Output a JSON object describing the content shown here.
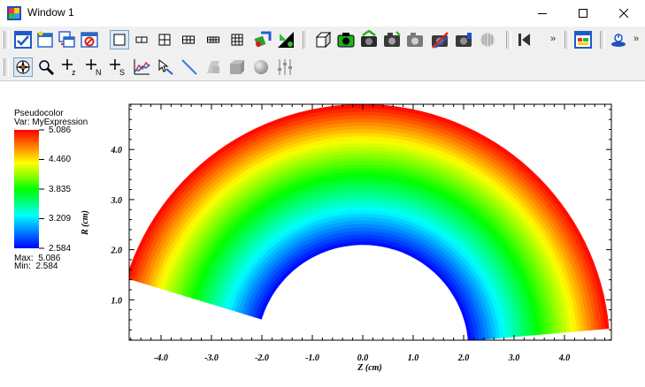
{
  "window": {
    "title": "Window 1",
    "caption_minimize": "—",
    "caption_maximize": "☐",
    "caption_close": "✕"
  },
  "toolbar1": {
    "overflow_1": "»",
    "overflow_2": "»"
  },
  "legend": {
    "title": "Pseudocolor",
    "variable": "Var: MyExpression",
    "ticks": [
      "5.086",
      "4.460",
      "3.835",
      "3.209",
      "2.584"
    ],
    "max_label": "Max:  5.086",
    "min_label": "Min:  2.584"
  },
  "plot": {
    "xlabel": "Z (cm)",
    "ylabel": "R (cm)",
    "x_ticks": [
      "-4.0",
      "-3.0",
      "-2.0",
      "-1.0",
      "0.0",
      "1.0",
      "2.0",
      "3.0",
      "4.0"
    ],
    "y_ticks": [
      "1.0",
      "2.0",
      "3.0",
      "4.0"
    ],
    "inner_radius": 2.1,
    "outer_radius": 4.9,
    "color_min": 2.584,
    "color_max": 5.086
  },
  "colors": {
    "titlebar_bg": "#ffffff",
    "toolbar_bg": "#f0f0f0",
    "red": "#ff0000",
    "blue": "#0000ff"
  }
}
